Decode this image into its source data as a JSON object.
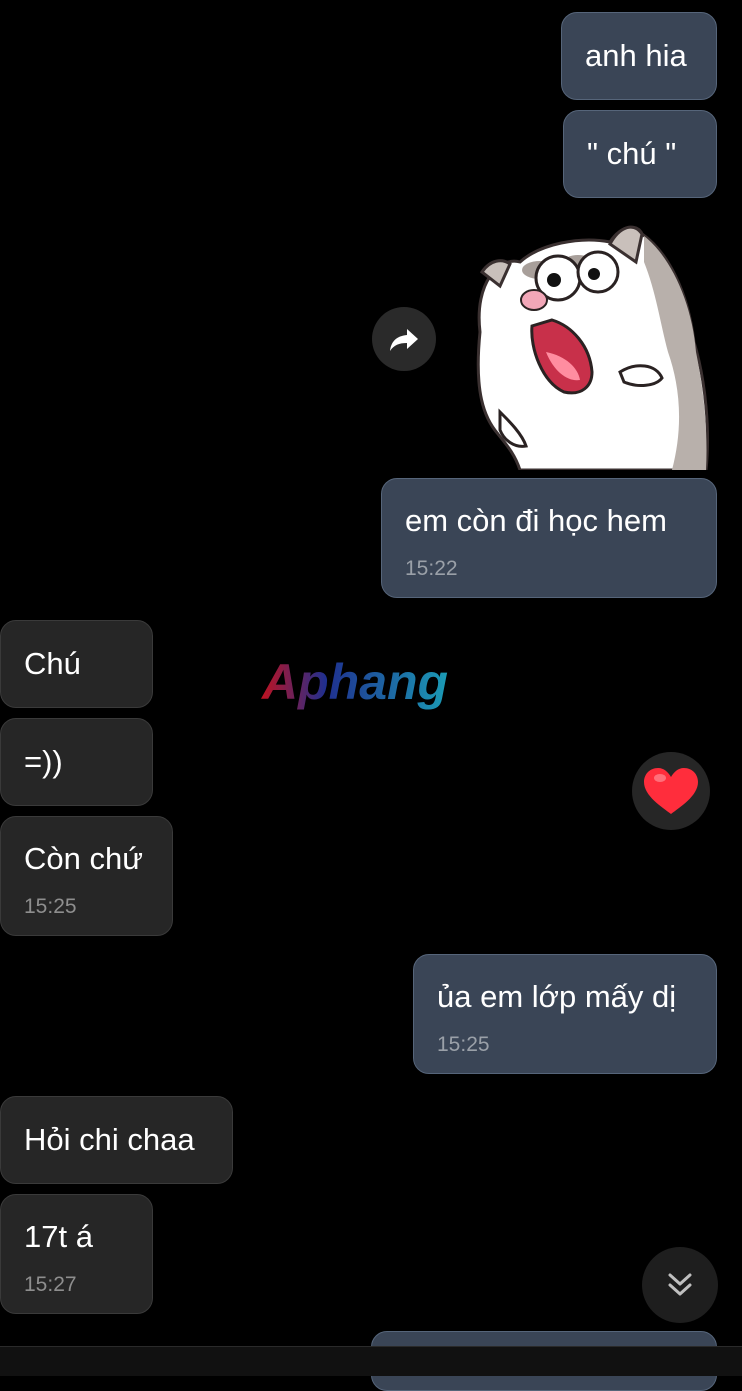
{
  "messages": [
    {
      "text": "anh hia",
      "time": ""
    },
    {
      "text": "\" chú \"",
      "time": ""
    },
    {
      "text": "em còn đi học hem",
      "time": "15:22"
    },
    {
      "text": "Chú",
      "time": ""
    },
    {
      "text": "=))",
      "time": ""
    },
    {
      "text": "Còn chứ",
      "time": "15:25"
    },
    {
      "text": "ủa em lớp mấy dị",
      "time": "15:25"
    },
    {
      "text": "Hỏi chi chaa",
      "time": ""
    },
    {
      "text": "17t á",
      "time": "15:27"
    }
  ],
  "watermark": {
    "text": "Aphang"
  },
  "reaction": {
    "emoji": "heart-emoji"
  },
  "icons": {
    "share": "share-forward-icon",
    "scroll_down": "chevron-double-down-icon",
    "sticker": "cat-sticker"
  },
  "colors": {
    "background": "#000000",
    "sent_bubble": "#3a4556",
    "received_bubble": "#262626",
    "heart": "#ff2d3c"
  }
}
